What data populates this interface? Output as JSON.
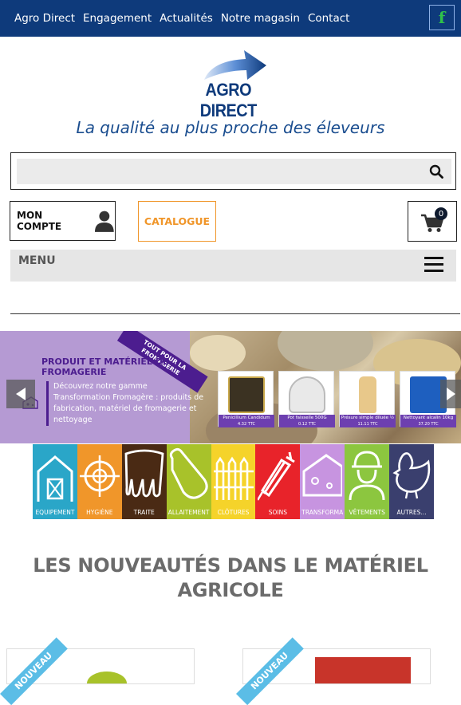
{
  "nav": {
    "links": [
      "Agro Direct",
      "Engagement",
      "Actualités",
      "Notre magasin",
      "Contact"
    ],
    "facebook_glyph": "f"
  },
  "brand": {
    "logo_text": "AGRO DIRECT",
    "tagline": "La qualité au plus proche des éleveurs"
  },
  "search": {
    "placeholder": "",
    "value": ""
  },
  "account": {
    "label": "MON COMPTE"
  },
  "catalogue": {
    "label": "CATALOGUE"
  },
  "cart": {
    "count": "0"
  },
  "menu": {
    "label": "MENU"
  },
  "banner": {
    "ribbon": "TOUT POUR LA FROMAGERIE",
    "title": "PRODUIT ET MATÉRIEL DE FROMAGERIE",
    "description": "Découvrez notre gamme Transformation Fromagère : produits de fabrication, matériel de fromagerie et nettoyage",
    "products": [
      {
        "name": "Penicillium Candidum",
        "price": "4.32 TTC"
      },
      {
        "name": "Pot faisselle 500G",
        "price": "0.12 TTC"
      },
      {
        "name": "Présure simple diluée ½",
        "price": "11.11 TTC"
      },
      {
        "name": "Nettoyant alcalin 10kg",
        "price": "37.20 TTC"
      }
    ]
  },
  "categories": [
    {
      "label": "EQUIPEMENT",
      "color": "#2aa6c8"
    },
    {
      "label": "HYGIÈNE",
      "color": "#f0962a"
    },
    {
      "label": "TRAITE",
      "color": "#4a2a14"
    },
    {
      "label": "ALLAITEMENT",
      "color": "#a8c22a"
    },
    {
      "label": "CLÔTURES",
      "color": "#f5d32a"
    },
    {
      "label": "SOINS",
      "color": "#e8232a"
    },
    {
      "label": "TRANSFORMA",
      "color": "#c794e0"
    },
    {
      "label": "VÊTEMENTS",
      "color": "#8cc63f"
    },
    {
      "label": "AUTRES...",
      "color": "#3a3f6e"
    }
  ],
  "section": {
    "title": "LES NOUVEAUTÉS DANS LE MATÉRIEL AGRICOLE"
  },
  "new_badge": "NOUVEAU",
  "colors": {
    "navy": "#0e3a7b",
    "orange": "#f0962a",
    "purple": "#4c1d8f",
    "new_blue": "#5bbde6"
  }
}
